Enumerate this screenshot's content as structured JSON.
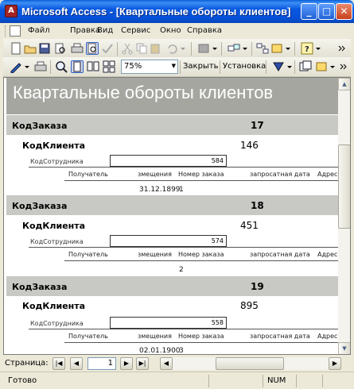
{
  "window": {
    "title": "Microsoft Access - [Квартальные обороты клиентов]",
    "app_icon_letter": "A"
  },
  "menu": {
    "items": [
      "Файл",
      "Правка",
      "Вид",
      "Сервис",
      "Окно",
      "Справка"
    ]
  },
  "toolbar": {
    "zoom": "75%",
    "close_label": "Закрыть",
    "setup_label": "Установка"
  },
  "report": {
    "title": "Квартальные обороты клиентов",
    "order_label": "КодЗаказа",
    "customer_label": "КодКлиента",
    "employee_label": "КодСотрудника",
    "columns": [
      "Получатель",
      "змещения",
      "Номер заказа",
      "запросатная дата",
      "Адрес"
    ],
    "groups": [
      {
        "order_id": "17",
        "customer_id": "146",
        "employee_id": "584",
        "row": [
          "31.12.1899",
          "1"
        ]
      },
      {
        "order_id": "18",
        "customer_id": "451",
        "employee_id": "574",
        "row": [
          "",
          "2"
        ]
      },
      {
        "order_id": "19",
        "customer_id": "895",
        "employee_id": "558",
        "row": [
          "02.01.1900",
          "3"
        ]
      }
    ]
  },
  "navigation": {
    "label": "Страница:",
    "page": "1"
  },
  "status": {
    "text": "Готово",
    "num": "NUM"
  }
}
